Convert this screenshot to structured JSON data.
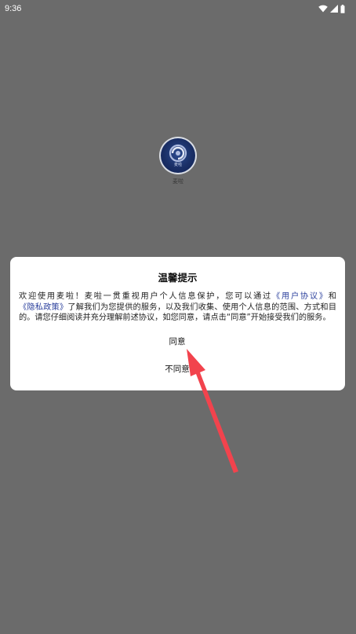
{
  "status_bar": {
    "time": "9:36",
    "icons": [
      "wifi-icon",
      "signal-icon",
      "battery-icon"
    ]
  },
  "splash": {
    "logo_text": "麦啦",
    "app_name": "麦啦"
  },
  "dialog": {
    "title": "温馨提示",
    "body_prefix": "欢迎使用麦啦！麦啦一贯重视用户个人信息保护，您可以通过",
    "user_agreement_link": "《用户协议》",
    "body_and": "和",
    "privacy_policy_link": "《隐私政策》",
    "body_suffix": "了解我们为您提供的服务，以及我们收集、使用个人信息的范围、方式和目的。请您仔细阅读并充分理解前述协议，如您同意，请点击“同意”开始接受我们的服务。",
    "agree_label": "同意",
    "disagree_label": "不同意"
  },
  "colors": {
    "overlay_bg": "#6b6b6b",
    "dialog_bg": "#ffffff",
    "link": "#2a3f9c",
    "arrow": "#f2434d"
  }
}
